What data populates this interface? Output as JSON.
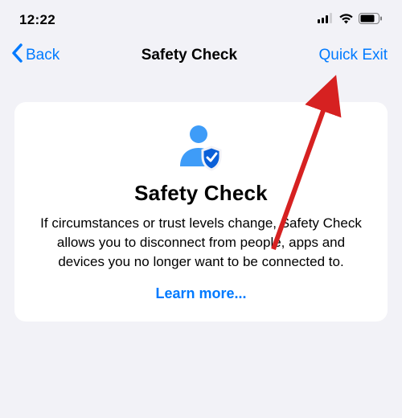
{
  "status_bar": {
    "time": "12:22"
  },
  "nav": {
    "back_label": "Back",
    "title": "Safety Check",
    "right_label": "Quick Exit"
  },
  "card": {
    "title": "Safety Check",
    "body": "If circumstances or trust levels change, Safety Check allows you to disconnect from people, apps and devices you no longer want to be connected to.",
    "link_label": "Learn more..."
  },
  "colors": {
    "accent": "#007aff",
    "background": "#f2f2f7",
    "card_bg": "#ffffff",
    "arrow": "#d62121"
  }
}
